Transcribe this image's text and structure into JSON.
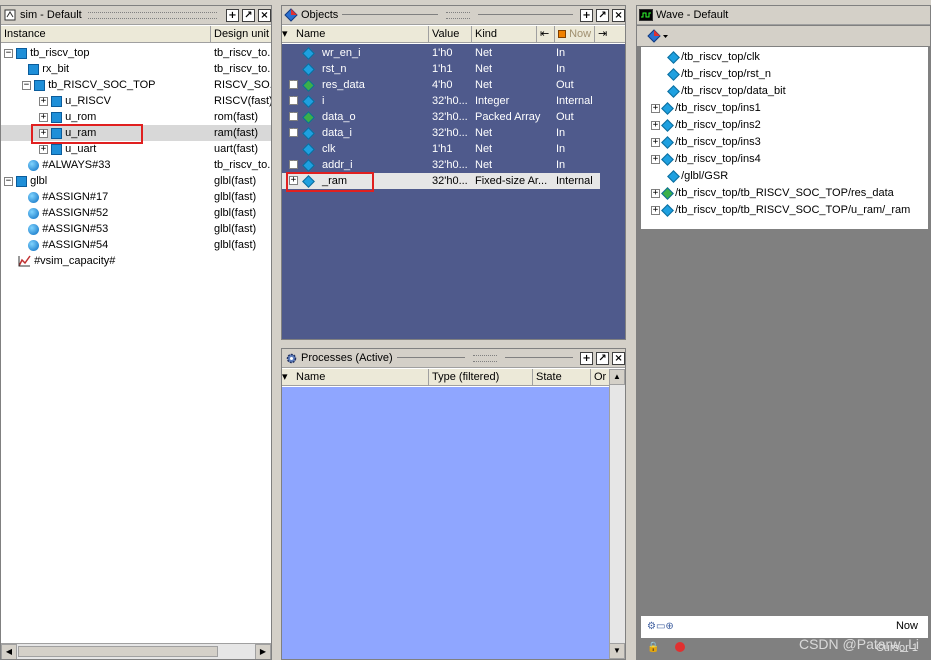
{
  "sim": {
    "title": "sim - Default",
    "columns": [
      "Instance",
      "Design unit"
    ],
    "rows": [
      {
        "name": "tb_riscv_top",
        "unit": "tb_riscv_to."
      },
      {
        "name": "rx_bit",
        "unit": "tb_riscv_to."
      },
      {
        "name": "tb_RISCV_SOC_TOP",
        "unit": "RISCV_SO.."
      },
      {
        "name": "u_RISCV",
        "unit": "RISCV(fast)"
      },
      {
        "name": "u_rom",
        "unit": "rom(fast)"
      },
      {
        "name": "u_ram",
        "unit": "ram(fast)"
      },
      {
        "name": "u_uart",
        "unit": "uart(fast)"
      },
      {
        "name": "#ALWAYS#33",
        "unit": "tb_riscv_to."
      },
      {
        "name": "glbl",
        "unit": "glbl(fast)"
      },
      {
        "name": "#ASSIGN#17",
        "unit": "glbl(fast)"
      },
      {
        "name": "#ASSIGN#52",
        "unit": "glbl(fast)"
      },
      {
        "name": "#ASSIGN#53",
        "unit": "glbl(fast)"
      },
      {
        "name": "#ASSIGN#54",
        "unit": "glbl(fast)"
      },
      {
        "name": "#vsim_capacity#",
        "unit": ""
      }
    ]
  },
  "objects": {
    "title": "Objects",
    "columns": [
      "Name",
      "Value",
      "Kind"
    ],
    "now_label": "Now",
    "rows": [
      {
        "name": "wr_en_i",
        "value": "1'h0",
        "kind": "Net",
        "mode": "In"
      },
      {
        "name": "rst_n",
        "value": "1'h1",
        "kind": "Net",
        "mode": "In"
      },
      {
        "name": "res_data",
        "value": "4'h0",
        "kind": "Net",
        "mode": "Out"
      },
      {
        "name": "i",
        "value": "32'h0...",
        "kind": "Integer",
        "mode": "Internal"
      },
      {
        "name": "data_o",
        "value": "32'h0...",
        "kind": "Packed Array",
        "mode": "Out"
      },
      {
        "name": "data_i",
        "value": "32'h0...",
        "kind": "Net",
        "mode": "In"
      },
      {
        "name": "clk",
        "value": "1'h1",
        "kind": "Net",
        "mode": "In"
      },
      {
        "name": "addr_i",
        "value": "32'h0...",
        "kind": "Net",
        "mode": "In"
      },
      {
        "name": "_ram",
        "value": "32'h0...",
        "kind": "Fixed-size Ar...",
        "mode": "Internal"
      }
    ]
  },
  "processes": {
    "title": "Processes (Active)",
    "columns": [
      "Name",
      "Type (filtered)",
      "State",
      "Or"
    ]
  },
  "wave": {
    "title": "Wave - Default",
    "signals": [
      "/tb_riscv_top/clk",
      "/tb_riscv_top/rst_n",
      "/tb_riscv_top/data_bit",
      "/tb_riscv_top/ins1",
      "/tb_riscv_top/ins2",
      "/tb_riscv_top/ins3",
      "/tb_riscv_top/ins4",
      "/glbl/GSR",
      "/tb_riscv_top/tb_RISCV_SOC_TOP/res_data",
      "/tb_riscv_top/tb_RISCV_SOC_TOP/u_ram/_ram"
    ],
    "now_label": "Now",
    "cursor_label": "Cursor 1"
  },
  "watermark": "CSDN @Patarw_Li",
  "colors": {
    "objects_bg": "#4f5a8c",
    "processes_bg": "#8fa6ff",
    "wave_bg": "#808080",
    "highlight": "#e02020"
  }
}
